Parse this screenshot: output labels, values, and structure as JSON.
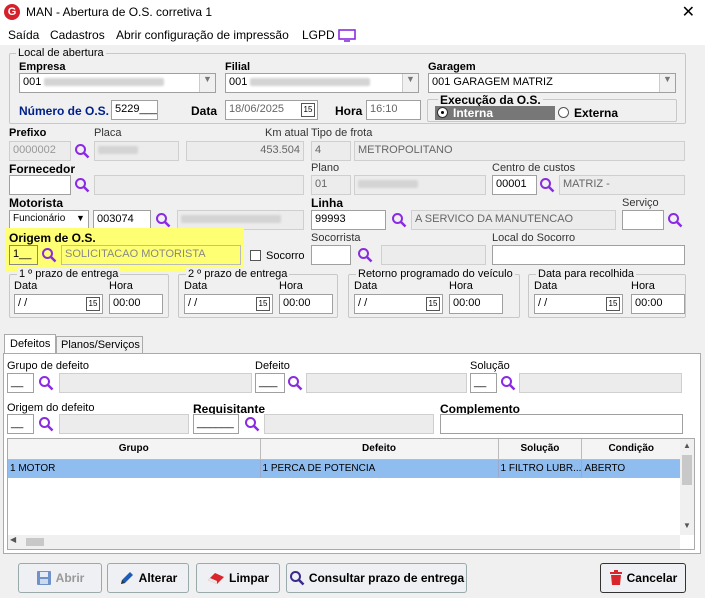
{
  "window": {
    "title": "MAN - Abertura de O.S. corretiva 1",
    "logo": "G",
    "close": "✕"
  },
  "menu": {
    "items": [
      "Saída",
      "Cadastros",
      "Abrir configuração de impressão",
      "LGPD"
    ]
  },
  "local": {
    "legend": "Local de abertura",
    "empresa_label": "Empresa",
    "empresa_value": "001",
    "filial_label": "Filial",
    "filial_value": "001",
    "garagem_label": "Garagem",
    "garagem_value": "001 GARAGEM MATRIZ",
    "numero_os_label": "Número de O.S.",
    "numero_os_value": "5229___",
    "data_label": "Data",
    "data_value": "18/06/2025",
    "hora_label": "Hora",
    "hora_value": "16:10",
    "execucao_label": "Execução da O.S.",
    "interna": "Interna",
    "externa": "Externa"
  },
  "veiculo": {
    "prefixo_label": "Prefixo",
    "prefixo_value": "0000002",
    "placa_label": "Placa",
    "km_label": "Km atual",
    "km_value": "453.504",
    "tipo_frota_label": "Tipo de frota",
    "tipo_frota_code": "4",
    "tipo_frota_value": "METROPOLITANO"
  },
  "fornecedor": {
    "label": "Fornecedor",
    "plano_label": "Plano",
    "plano_code": "01",
    "centro_label": "Centro de custos",
    "centro_code": "00001",
    "centro_value": "MATRIZ -"
  },
  "motorista": {
    "label": "Motorista",
    "tipo": "Funcionário",
    "code": "003074",
    "linha_label": "Linha",
    "linha_code": "99993",
    "linha_value": "A SERVICO DA MANUTENCAO",
    "servico_label": "Serviço"
  },
  "origem": {
    "label": "Origem de O.S.",
    "code": "1__",
    "value": "SOLICITACAO MOTORISTA",
    "socorro_label": "Socorro",
    "socorrista_label": "Socorrista",
    "local_socorro_label": "Local do Socorro"
  },
  "prazos": [
    {
      "title": "1 º prazo de entrega",
      "data_label": "Data",
      "date": " / /",
      "hora_label": "Hora",
      "hora": "00:00"
    },
    {
      "title": "2 º prazo de entrega",
      "data_label": "Data",
      "date": " / /",
      "hora_label": "Hora",
      "hora": "00:00"
    },
    {
      "title": "Retorno programado do veículo",
      "data_label": "Data",
      "date": " / /",
      "hora_label": "Hora",
      "hora": "00:00"
    },
    {
      "title": "Data para recolhida",
      "data_label": "Data",
      "date": " / /",
      "hora_label": "Hora",
      "hora": "00:00"
    }
  ],
  "tabs": [
    "Defeitos",
    "Planos/Serviços"
  ],
  "defeitos": {
    "grupo_label": "Grupo de defeito",
    "grupo_value": "__",
    "defeito_label": "Defeito",
    "defeito_value": "___",
    "solucao_label": "Solução",
    "solucao_value": "__",
    "origem_label": "Origem do defeito",
    "origem_value": "__",
    "requisitante_label": "Requisitante",
    "requisitante_value": "______",
    "complemento_label": "Complemento"
  },
  "grid": {
    "columns": [
      "Grupo",
      "Defeito",
      "Solução",
      "Condição"
    ],
    "rows": [
      [
        "1 MOTOR",
        "1 PERCA DE POTENCIA",
        "1 FILTRO LUBR...",
        "ABERTO"
      ]
    ]
  },
  "buttons": {
    "abrir": "Abrir",
    "alterar": "Alterar",
    "limpar": "Limpar",
    "consultar": "Consultar prazo de entrega",
    "cancelar": "Cancelar"
  },
  "cal_icon": "15"
}
